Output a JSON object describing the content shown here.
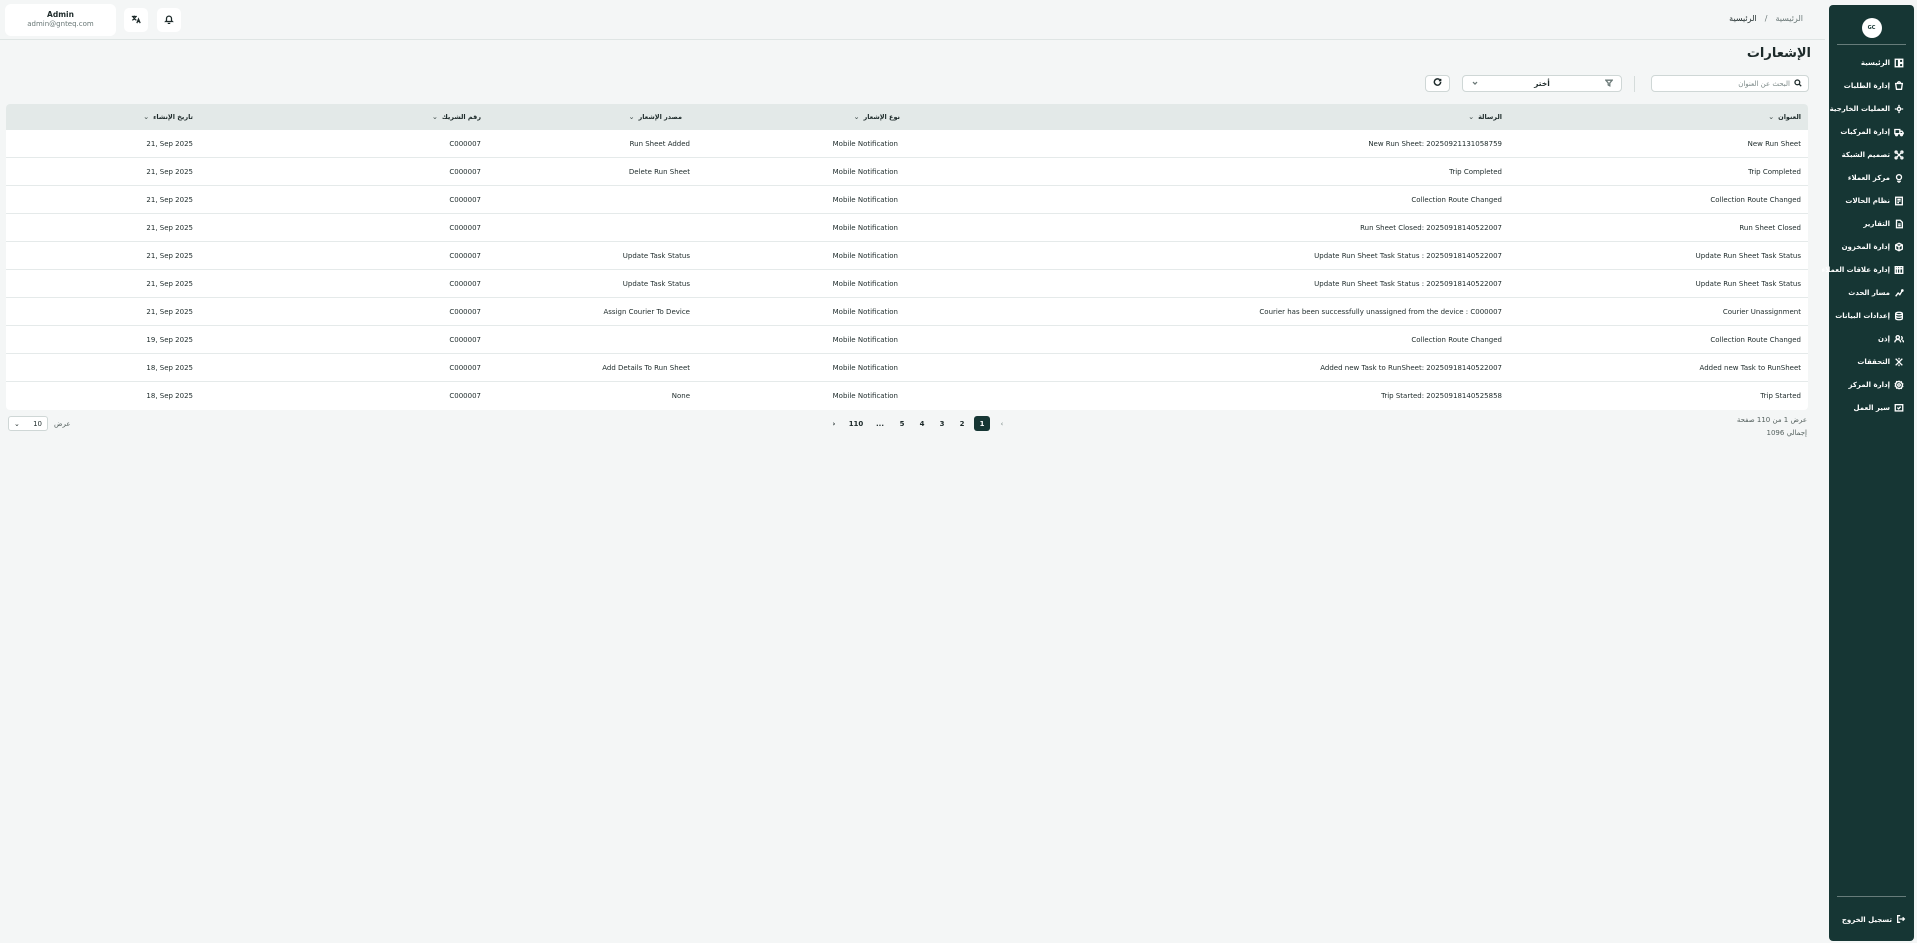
{
  "sidebar": {
    "logo_text": "GC",
    "items": [
      {
        "label": "الرئيسية",
        "icon": "dashboard-icon"
      },
      {
        "label": "إدارة الطلبات",
        "icon": "orders-icon"
      },
      {
        "label": "العمليات الخارجية",
        "icon": "external-ops-icon"
      },
      {
        "label": "إدارة المركبات",
        "icon": "truck-icon"
      },
      {
        "label": "تصميم الشبكة",
        "icon": "network-icon"
      },
      {
        "label": "مركز العملاء",
        "icon": "customer-center-icon"
      },
      {
        "label": "نظام الحالات",
        "icon": "status-system-icon"
      },
      {
        "label": "التقارير",
        "icon": "reports-icon"
      },
      {
        "label": "إدارة المخزون",
        "icon": "inventory-icon"
      },
      {
        "label": "إدارة علاقات العملاء",
        "icon": "crm-icon"
      },
      {
        "label": "مسار الحدث",
        "icon": "event-path-icon"
      },
      {
        "label": "إعدادات البيانات",
        "icon": "database-icon"
      },
      {
        "label": "إذن",
        "icon": "permission-icon"
      },
      {
        "label": "التحققات",
        "icon": "verification-icon"
      },
      {
        "label": "إدارة المركز",
        "icon": "center-management-icon"
      },
      {
        "label": "سير العمل",
        "icon": "workflow-icon"
      }
    ],
    "logout_label": "تسجيل الخروج"
  },
  "header": {
    "breadcrumb": [
      "الرئيسية",
      "الرئيسية"
    ],
    "user_name": "Admin",
    "user_email": "admin@gnteq.com"
  },
  "main": {
    "title": "الإشعارات",
    "search_placeholder": "البحث عن العنوان",
    "filter_value": "أختر"
  },
  "table": {
    "columns": [
      "العنوان",
      "الرسالة",
      "نوع الإشعار",
      "مصدر الإشعار",
      "رقم الشريك",
      "تاريخ الإنشاء"
    ],
    "rows": [
      [
        "New Run Sheet",
        "New Run Sheet: 20250921131058759",
        "Mobile Notification",
        "Run Sheet Added",
        "C000007",
        "21, Sep 2025"
      ],
      [
        "Trip Completed",
        "Trip Completed",
        "Mobile Notification",
        "Delete Run Sheet",
        "C000007",
        "21, Sep 2025"
      ],
      [
        "Collection Route Changed",
        "Collection Route Changed",
        "Mobile Notification",
        "",
        "C000007",
        "21, Sep 2025"
      ],
      [
        "Run Sheet Closed",
        "Run Sheet Closed: 20250918140522007",
        "Mobile Notification",
        "",
        "C000007",
        "21, Sep 2025"
      ],
      [
        "Update Run Sheet Task Status",
        "Update Run Sheet Task Status : 20250918140522007",
        "Mobile Notification",
        "Update Task Status",
        "C000007",
        "21, Sep 2025"
      ],
      [
        "Update Run Sheet Task Status",
        "Update Run Sheet Task Status : 20250918140522007",
        "Mobile Notification",
        "Update Task Status",
        "C000007",
        "21, Sep 2025"
      ],
      [
        "Courier Unassignment",
        "Courier has been successfully unassigned from the device : C000007",
        "Mobile Notification",
        "Assign Courier To Device",
        "C000007",
        "21, Sep 2025"
      ],
      [
        "Collection Route Changed",
        "Collection Route Changed",
        "Mobile Notification",
        "",
        "C000007",
        "19, Sep 2025"
      ],
      [
        "Added new Task to RunSheet",
        "Added new Task to RunSheet: 20250918140522007",
        "Mobile Notification",
        "Add Details To Run Sheet",
        "C000007",
        "18, Sep 2025"
      ],
      [
        "Trip Started",
        "Trip Started: 20250918140525858",
        "Mobile Notification",
        "None",
        "C000007",
        "18, Sep 2025"
      ]
    ]
  },
  "pagination": {
    "info_line1": "عرض 1 من 110 صفحة",
    "info_line2": "إجمالي 1096",
    "pages": [
      "1",
      "2",
      "3",
      "4",
      "5",
      "...",
      "110"
    ],
    "active_page": "1",
    "per_page_label": "عرض",
    "per_page_value": "10"
  }
}
